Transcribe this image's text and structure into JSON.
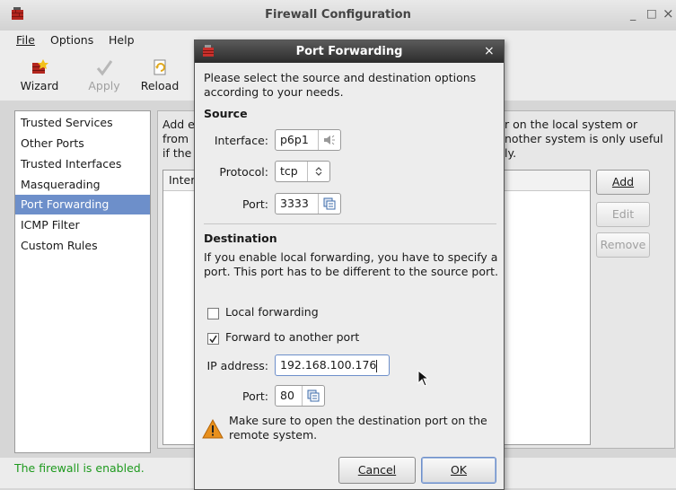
{
  "main_window": {
    "title": "Firewall Configuration",
    "controls": {
      "minimize": "_",
      "maximize": "□",
      "close": "×"
    },
    "menu": [
      "File",
      "Options",
      "Help"
    ],
    "toolbar": [
      {
        "label": "Wizard",
        "icon": "wizard-icon",
        "enabled": true
      },
      {
        "label": "Apply",
        "icon": "checkmark-icon",
        "enabled": false
      },
      {
        "label": "Reload",
        "icon": "reload-icon",
        "enabled": true
      }
    ],
    "sidebar": {
      "items": [
        "Trusted Services",
        "Other Ports",
        "Trusted Interfaces",
        "Masquerading",
        "Port Forwarding",
        "ICMP Filter",
        "Custom Rules"
      ],
      "selected": "Port Forwarding"
    },
    "content": {
      "description_left": "Add e\nfrom \nif the",
      "description_right": "r on the local system or\nnother system is only useful\nly.",
      "list_header": "Inter",
      "buttons": {
        "add": "Add",
        "edit": "Edit",
        "remove": "Remove"
      }
    },
    "status": "The firewall is enabled."
  },
  "dialog": {
    "title": "Port Forwarding",
    "close": "×",
    "intro": "Please select the source and destination options according to your needs.",
    "source": {
      "heading": "Source",
      "interface_label": "Interface:",
      "interface_value": "p6p1",
      "protocol_label": "Protocol:",
      "protocol_value": "tcp",
      "port_label": "Port:",
      "port_value": "3333"
    },
    "destination": {
      "heading": "Destination",
      "text": "If you enable local forwarding, you have to specify a port. This port has to be different to the source port.",
      "local_forwarding_label": "Local forwarding",
      "local_forwarding_checked": false,
      "forward_label": "Forward to another port",
      "forward_checked": true,
      "ip_label": "IP address:",
      "ip_value": "192.168.100.176",
      "port_label": "Port:",
      "port_value": "80"
    },
    "warning": "Make sure to open the destination port on the remote system.",
    "buttons": {
      "cancel": "Cancel",
      "ok": "OK"
    }
  },
  "colors": {
    "selection": "#6d8fca",
    "status_green": "#1e9a1e",
    "dialog_title_bg": "#3a3a3a",
    "warning": "#e8901c"
  }
}
